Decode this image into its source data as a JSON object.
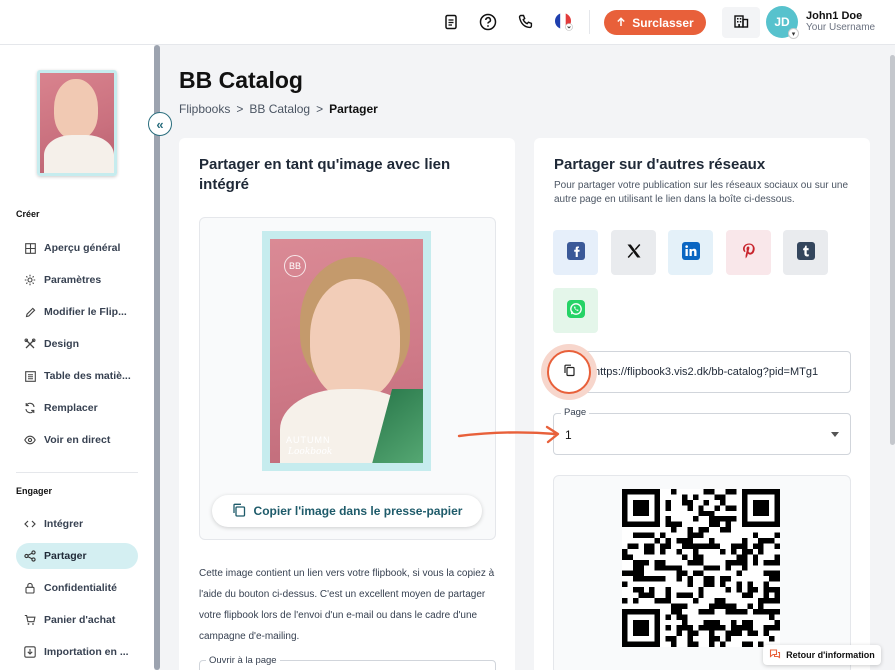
{
  "header": {
    "upgrade_label": "Surclasser",
    "avatar_initials": "JD",
    "user_name": "John1 Doe",
    "user_sub": "Your Username",
    "accent": "#e8603a",
    "avatar_color": "#57c2cd"
  },
  "sidebar": {
    "section_create": "Créer",
    "section_engage": "Engager",
    "create_items": [
      {
        "label": "Aperçu général",
        "icon": "layout-icon"
      },
      {
        "label": "Paramètres",
        "icon": "gear-icon"
      },
      {
        "label": "Modifier le Flip...",
        "icon": "pencil-icon"
      },
      {
        "label": "Design",
        "icon": "tools-icon"
      },
      {
        "label": "Table des matiè...",
        "icon": "list-icon"
      },
      {
        "label": "Remplacer",
        "icon": "refresh-icon"
      },
      {
        "label": "Voir en direct",
        "icon": "eye-icon"
      }
    ],
    "engage_items": [
      {
        "label": "Intégrer",
        "icon": "code-icon"
      },
      {
        "label": "Partager",
        "icon": "share-icon"
      },
      {
        "label": "Confidentialité",
        "icon": "lock-icon"
      },
      {
        "label": "Panier d'achat",
        "icon": "cart-icon"
      },
      {
        "label": "Importation en ...",
        "icon": "import-icon"
      }
    ],
    "active_color": "#d4eff2"
  },
  "main": {
    "title": "BB Catalog",
    "breadcrumb": [
      "Flipbooks",
      ">",
      "BB Catalog",
      ">",
      "Partager"
    ],
    "image_card": {
      "title": "Partager en tant qu'image avec lien intégré",
      "cover_line1": "AUTUMN",
      "cover_line2": "Lookbook",
      "cover_logo": "BB",
      "copy_button": "Copier l'image dans le presse-papier",
      "description": "Cette image contient un lien vers votre flipbook, si vous la copiez à l'aide du bouton ci-dessus. C'est un excellent moyen de partager votre flipbook lors de l'envoi d'un e-mail ou dans le cadre d'une campagne d'e-mailing.",
      "open_page_label": "Ouvrir à la page"
    },
    "share_card": {
      "title": "Partager sur d'autres réseaux",
      "subtitle": "Pour partager votre publication sur les réseaux sociaux ou sur une autre page en utilisant le lien dans la boîte ci-dessous.",
      "link": "https://flipbook3.vis2.dk/bb-catalog?pid=MTg1",
      "page_label": "Page",
      "page_value": "1"
    }
  },
  "feedback_label": "Retour d'information"
}
